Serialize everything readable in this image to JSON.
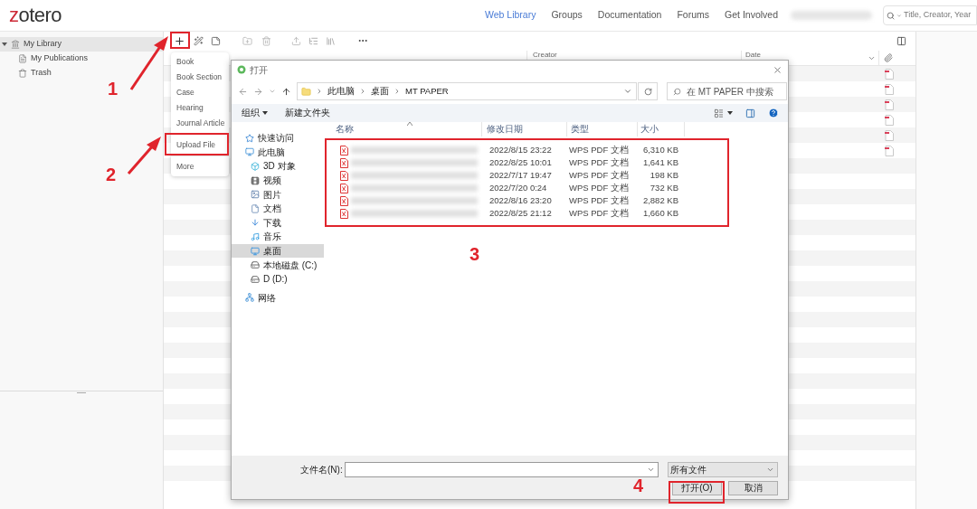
{
  "header": {
    "logo": "zotero",
    "nav": [
      {
        "label": "Web Library",
        "selected": true
      },
      {
        "label": "Groups",
        "selected": false
      },
      {
        "label": "Documentation",
        "selected": false
      },
      {
        "label": "Forums",
        "selected": false
      },
      {
        "label": "Get Involved",
        "selected": false
      }
    ],
    "search": {
      "placeholder": "Title, Creator, Year"
    }
  },
  "sidebar": {
    "items": [
      {
        "label": "My Library",
        "selected": true,
        "expanded": true,
        "kind": "library",
        "children": [
          {
            "label": "My Publications",
            "selected": false,
            "kind": "publications"
          },
          {
            "label": "Trash",
            "selected": false,
            "kind": "trash"
          }
        ]
      }
    ]
  },
  "table": {
    "columns": [
      "Creator",
      "Date"
    ],
    "rows": [
      {
        "attachment": true
      },
      {
        "attachment": true
      },
      {
        "attachment": true
      },
      {
        "attachment": true
      },
      {
        "attachment": true
      },
      {
        "attachment": true
      }
    ]
  },
  "new_item_menu": {
    "items": [
      {
        "label": "Book",
        "kind": "item"
      },
      {
        "label": "Book Section",
        "kind": "item"
      },
      {
        "label": "Case",
        "kind": "item"
      },
      {
        "label": "Hearing",
        "kind": "item"
      },
      {
        "label": "Journal Article",
        "kind": "item"
      },
      {
        "kind": "divider"
      },
      {
        "label": "Upload File",
        "kind": "item"
      },
      {
        "kind": "divider"
      },
      {
        "label": "More",
        "kind": "item"
      }
    ]
  },
  "dialog": {
    "title": "打开",
    "path": [
      "此电脑",
      "桌面",
      "MT PAPER"
    ],
    "search": {
      "placeholder": "在 MT PAPER 中搜索"
    },
    "toolbar": {
      "organize": "组织",
      "new_folder": "新建文件夹"
    },
    "nav": [
      {
        "label": "快速访问",
        "kind": "star",
        "selected": false
      },
      {
        "label": "此电脑",
        "kind": "pc",
        "selected": false,
        "children": [
          {
            "label": "3D 对象",
            "kind": "cube",
            "selected": false
          },
          {
            "label": "视频",
            "kind": "video",
            "selected": false
          },
          {
            "label": "图片",
            "kind": "image",
            "selected": false
          },
          {
            "label": "文档",
            "kind": "doc",
            "selected": false
          },
          {
            "label": "下载",
            "kind": "download",
            "selected": false
          },
          {
            "label": "音乐",
            "kind": "music",
            "selected": false
          },
          {
            "label": "桌面",
            "kind": "desktop",
            "selected": true
          },
          {
            "label": "本地磁盘 (C:)",
            "kind": "drive",
            "selected": false
          },
          {
            "label": "D (D:)",
            "kind": "drive",
            "selected": false
          }
        ]
      },
      {
        "label": "网络",
        "kind": "network",
        "selected": false
      }
    ],
    "columns": [
      "名称",
      "修改日期",
      "类型",
      "大小"
    ],
    "files": [
      {
        "date": "2022/8/15 23:22",
        "type": "WPS PDF 文档",
        "size": "6,310 KB"
      },
      {
        "date": "2022/8/25 10:01",
        "type": "WPS PDF 文档",
        "size": "1,641 KB"
      },
      {
        "date": "2022/7/17 19:47",
        "type": "WPS PDF 文档",
        "size": "198 KB"
      },
      {
        "date": "2022/7/20 0:24",
        "type": "WPS PDF 文档",
        "size": "732 KB"
      },
      {
        "date": "2022/8/16 23:20",
        "type": "WPS PDF 文档",
        "size": "2,882 KB"
      },
      {
        "date": "2022/8/25 21:12",
        "type": "WPS PDF 文档",
        "size": "1,660 KB"
      }
    ],
    "filename_label": "文件名(N):",
    "filetype": "所有文件",
    "buttons": [
      "打开(O)",
      "取消"
    ]
  },
  "annotations": [
    {
      "label": "1"
    },
    {
      "label": "2"
    },
    {
      "label": "3"
    },
    {
      "label": "4"
    }
  ]
}
